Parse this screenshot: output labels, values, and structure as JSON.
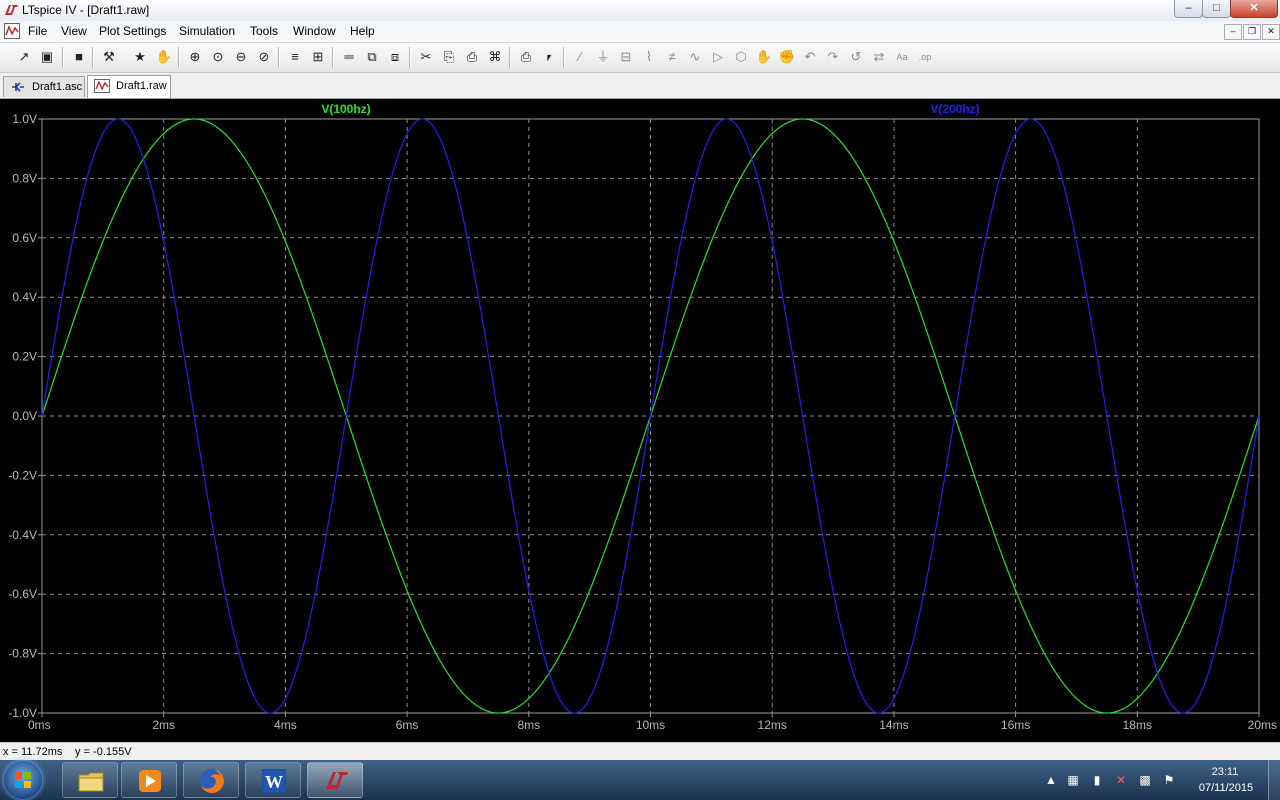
{
  "window": {
    "title": "LTspice IV - [Draft1.raw]",
    "min_glyph": "–",
    "max_glyph": "□",
    "close_glyph": "✕"
  },
  "menu": {
    "items": [
      "File",
      "View",
      "Plot Settings",
      "Simulation",
      "Tools",
      "Window",
      "Help"
    ],
    "mdi_min": "–",
    "mdi_restore": "❐",
    "mdi_close": "✕"
  },
  "toolbar": {
    "icons": [
      {
        "name": "plot-settings-icon",
        "glyph": "↗"
      },
      {
        "name": "open-icon",
        "glyph": "▣"
      },
      {
        "name": "save-icon",
        "glyph": "■"
      },
      {
        "name": "control-panel-icon",
        "glyph": "⚒"
      },
      {
        "name": "run-icon",
        "glyph": "★"
      },
      {
        "name": "halt-icon",
        "glyph": "✋"
      },
      {
        "name": "zoom-in-icon",
        "glyph": "⊕"
      },
      {
        "name": "zoom-pan-icon",
        "glyph": "⊙"
      },
      {
        "name": "zoom-out-icon",
        "glyph": "⊖"
      },
      {
        "name": "zoom-full-icon",
        "glyph": "⊘"
      },
      {
        "name": "autorange-icon",
        "glyph": "≡"
      },
      {
        "name": "fit-icon",
        "glyph": "⊞"
      },
      {
        "name": "tile-horizontal-icon",
        "glyph": "═"
      },
      {
        "name": "cascade-icon",
        "glyph": "⧉"
      },
      {
        "name": "tile-vertical-icon",
        "glyph": "⧈"
      },
      {
        "name": "cut-icon",
        "glyph": "✂"
      },
      {
        "name": "copy-icon",
        "glyph": "⎘"
      },
      {
        "name": "paste-icon",
        "glyph": "⎙"
      },
      {
        "name": "find-icon",
        "glyph": "⌘"
      },
      {
        "name": "print-setup-icon",
        "glyph": "⎙"
      },
      {
        "name": "print-icon",
        "glyph": "⎖"
      },
      {
        "name": "wire-icon",
        "glyph": "∕"
      },
      {
        "name": "ground-icon",
        "glyph": "⏚"
      },
      {
        "name": "label-icon",
        "glyph": "⊟"
      },
      {
        "name": "resistor-icon",
        "glyph": "⌇"
      },
      {
        "name": "capacitor-icon",
        "glyph": "≠"
      },
      {
        "name": "inductor-icon",
        "glyph": "∿"
      },
      {
        "name": "diode-icon",
        "glyph": "▷"
      },
      {
        "name": "component-icon",
        "glyph": "⬡"
      },
      {
        "name": "move-icon",
        "glyph": "✋"
      },
      {
        "name": "drag-icon",
        "glyph": "✊"
      },
      {
        "name": "undo-icon",
        "glyph": "↶"
      },
      {
        "name": "redo-icon",
        "glyph": "↷"
      },
      {
        "name": "rotate-icon",
        "glyph": "↺"
      },
      {
        "name": "mirror-icon",
        "glyph": "⇄"
      },
      {
        "name": "text-icon",
        "glyph": "Aa"
      },
      {
        "name": "spice-directive-icon",
        "glyph": ".op"
      }
    ]
  },
  "tabs": [
    {
      "label": "Draft1.asc",
      "icon": "schematic-icon",
      "active": false
    },
    {
      "label": "Draft1.raw",
      "icon": "waveform-icon",
      "active": true
    }
  ],
  "chart_data": {
    "type": "line",
    "title": "",
    "xlabel": "",
    "ylabel": "",
    "xlim": [
      0,
      20
    ],
    "ylim": [
      -1.0,
      1.0
    ],
    "x_unit": "ms",
    "grid": true,
    "background": "#000000",
    "x_ticks": [
      "0ms",
      "2ms",
      "4ms",
      "6ms",
      "8ms",
      "10ms",
      "12ms",
      "14ms",
      "16ms",
      "18ms",
      "20ms"
    ],
    "y_ticks": [
      "1.0V",
      "0.8V",
      "0.6V",
      "0.4V",
      "0.2V",
      "0.0V",
      "-0.2V",
      "-0.4V",
      "-0.6V",
      "-0.8V",
      "-1.0V"
    ],
    "series": [
      {
        "name": "V(100hz)",
        "color": "#27e227",
        "frequency_hz": 100,
        "amplitude": 1.0,
        "func": "sine",
        "x": [
          0,
          1.25,
          2.5,
          3.75,
          5,
          6.25,
          7.5,
          8.75,
          10,
          11.25,
          12.5,
          13.75,
          15,
          16.25,
          17.5,
          18.75,
          20
        ],
        "y": [
          0,
          0.707,
          1.0,
          0.707,
          0,
          -0.707,
          -1.0,
          -0.707,
          0,
          0.707,
          1.0,
          0.707,
          0,
          -0.707,
          -1.0,
          -0.707,
          0
        ]
      },
      {
        "name": "V(200hz)",
        "color": "#2020ee",
        "frequency_hz": 200,
        "amplitude": 1.0,
        "func": "sine",
        "x": [
          0,
          1.25,
          2.5,
          3.75,
          5,
          6.25,
          7.5,
          8.75,
          10,
          11.25,
          12.5,
          13.75,
          15,
          16.25,
          17.5,
          18.75,
          20
        ],
        "y": [
          0,
          1.0,
          0,
          -1.0,
          0,
          1.0,
          0,
          -1.0,
          0,
          1.0,
          0,
          -1.0,
          0,
          1.0,
          0,
          -1.0,
          0
        ]
      }
    ]
  },
  "status": {
    "x_readout": "x = 11.72ms",
    "y_readout": "y = -0.155V"
  },
  "taskbar": {
    "apps": [
      {
        "name": "explorer",
        "icon": "folder-icon"
      },
      {
        "name": "media-player",
        "icon": "media-player-icon"
      },
      {
        "name": "firefox",
        "icon": "firefox-icon"
      },
      {
        "name": "word",
        "icon": "word-icon",
        "glyph": "W"
      },
      {
        "name": "ltspice",
        "icon": "ltspice-icon",
        "active": true
      }
    ],
    "clock_time": "23:11",
    "clock_date": "07/11/2015"
  }
}
